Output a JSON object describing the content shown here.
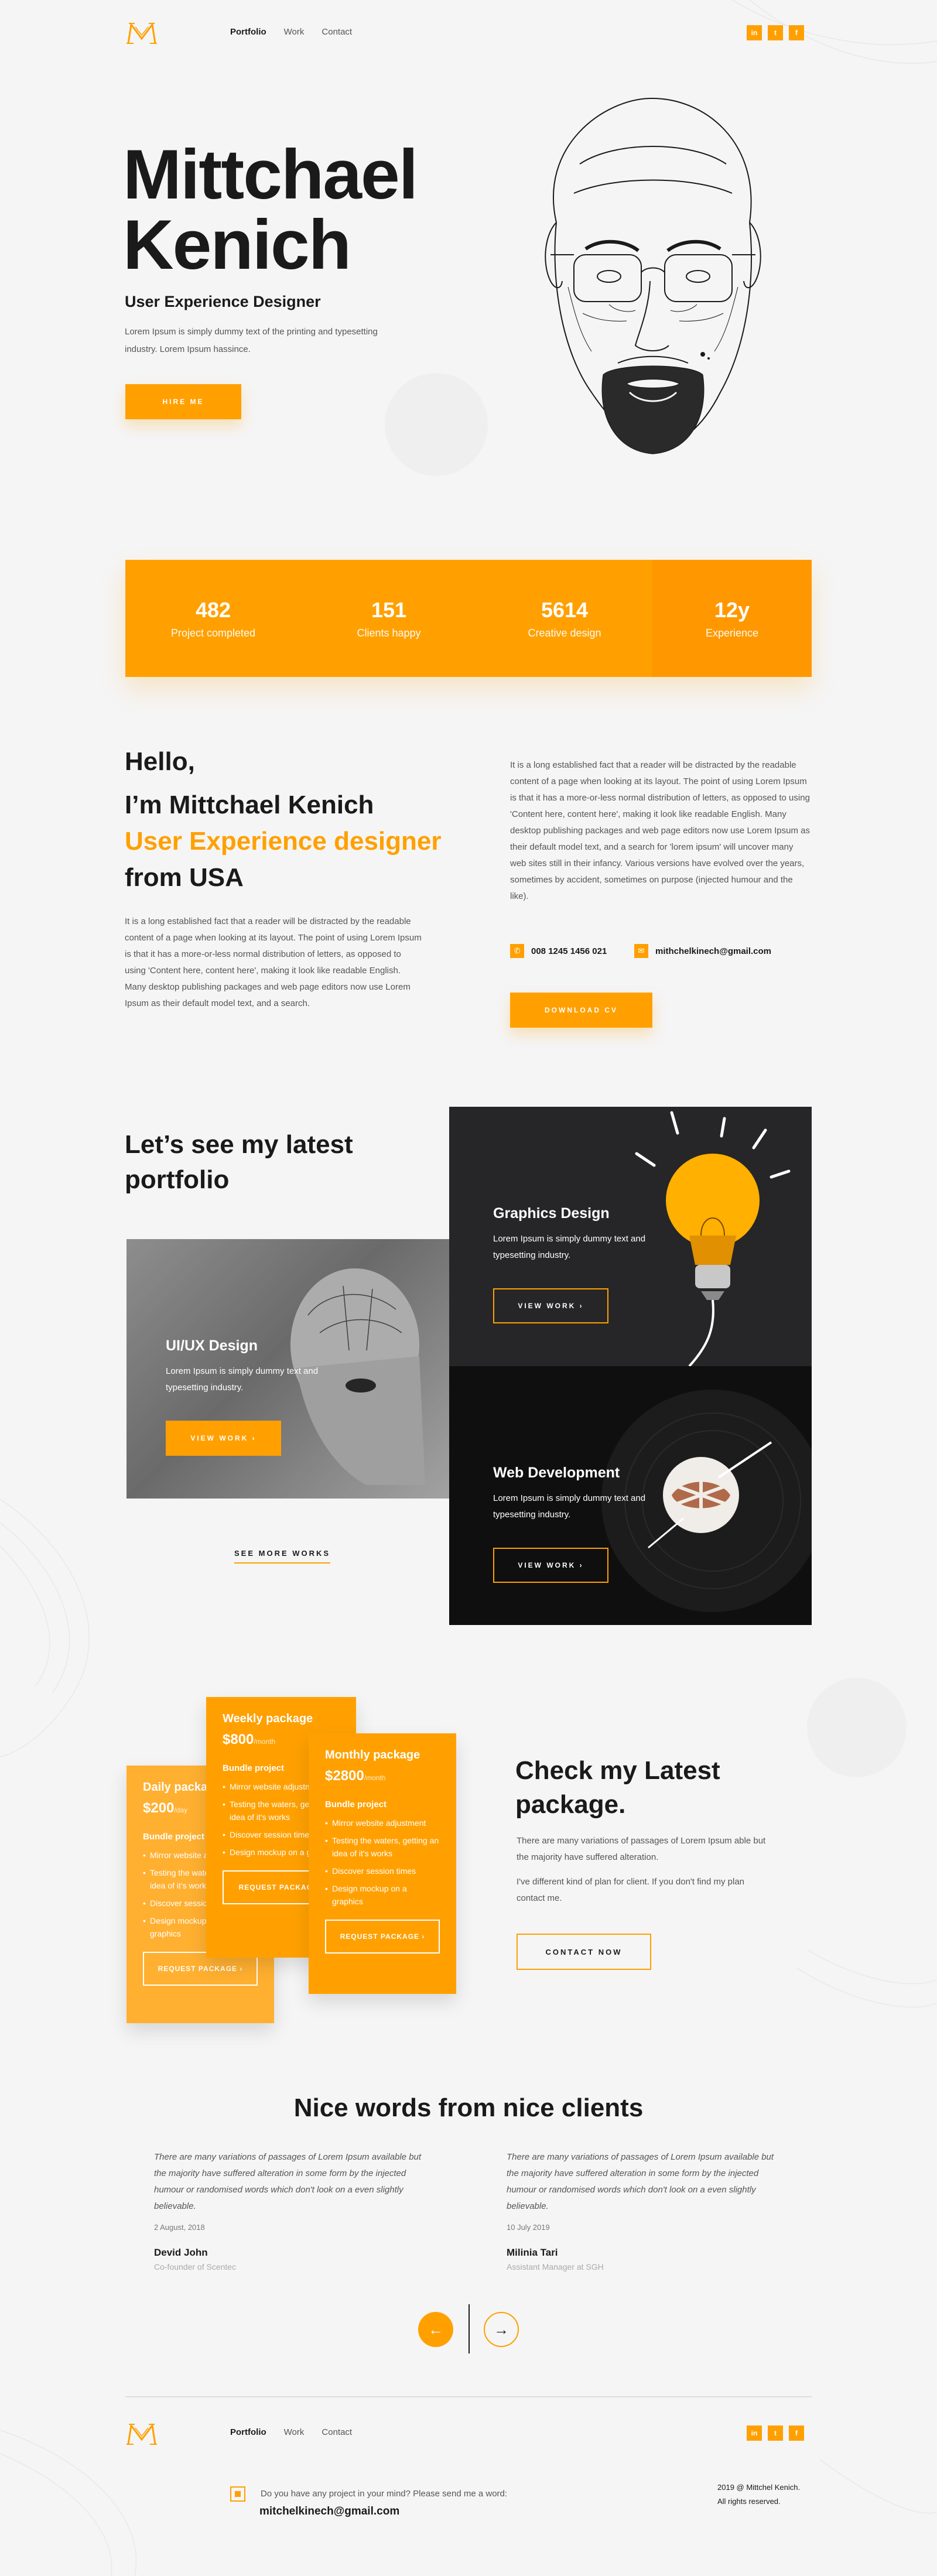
{
  "header": {
    "nav": [
      "Portfolio",
      "Work",
      "Contact"
    ],
    "social": [
      "in",
      "t",
      "f"
    ]
  },
  "hero": {
    "name_line1": "Mittchael",
    "name_line2": "Kenich",
    "role": "User Experience Designer",
    "desc": "Lorem Ipsum is simply dummy text of the printing and typesetting industry. Lorem Ipsum hassince.",
    "cta": "HIRE ME"
  },
  "stats": [
    {
      "value": "482",
      "label": "Project completed"
    },
    {
      "value": "151",
      "label": "Clients happy"
    },
    {
      "value": "5614",
      "label": "Creative design"
    },
    {
      "value": "12y",
      "label": "Experience"
    }
  ],
  "about": {
    "hello": "Hello,",
    "intro": "I’m Mittchael Kenich",
    "role": "User Experience designer",
    "from": "from USA",
    "para_left": "It is a long established fact that a reader will be distracted by the readable content of a page when looking at its layout. The point of using Lorem Ipsum is that it has a more-or-less normal distribution of letters, as opposed to using 'Content here, content here', making it look like readable English. Many desktop publishing packages and web page editors now use Lorem Ipsum as their default model text, and a search.",
    "para_right": "It is a long established fact that a reader will be distracted by the readable content of a page when looking at its layout. The point of using Lorem Ipsum is that it has a more-or-less normal distribution of letters, as opposed to using 'Content here, content here', making it look like readable English. Many desktop publishing packages and web page editors now use Lorem Ipsum as their default model text, and a search for 'lorem ipsum' will uncover many web sites still in their infancy. Various versions have evolved over the years, sometimes by accident, sometimes on purpose (injected humour and the like).",
    "phone": "008 1245 1456 021",
    "email": "mithchelkinech@gmail.com",
    "cta": "DOWNLOAD CV"
  },
  "portfolio": {
    "title_line1": "Let’s see my latest",
    "title_line2": "portfolio",
    "cards": [
      {
        "title": "UI/UX Design",
        "desc": "Lorem Ipsum is simply dummy text and typesetting industry.",
        "cta": "VIEW WORK ›"
      },
      {
        "title": "Graphics Design",
        "desc": "Lorem Ipsum is simply dummy text and typesetting industry.",
        "cta": "VIEW WORK ›"
      },
      {
        "title": "Web Development",
        "desc": "Lorem Ipsum is simply dummy text and typesetting industry.",
        "cta": "VIEW WORK ›"
      }
    ],
    "more": "SEE MORE WORKS"
  },
  "packages": {
    "items": [
      {
        "name": "Daily package",
        "price": "$200",
        "unit": "/day",
        "heading": "Bundle project",
        "features": [
          "Mirror website adjustment",
          "Testing the waters, getting an idea of it's works",
          "Discover session times",
          "Design mockup on a graphics"
        ],
        "cta": "REQUEST PACKAGE ›"
      },
      {
        "name": "Weekly package",
        "price": "$800",
        "unit": "/month",
        "heading": "Bundle project",
        "features": [
          "Mirror website adjustment",
          "Testing the waters, getting an idea of it's works",
          "Discover session times",
          "Design mockup on a graphics"
        ],
        "cta": "REQUEST PACKAGE ›"
      },
      {
        "name": "Monthly package",
        "price": "$2800",
        "unit": "/month",
        "heading": "Bundle project",
        "features": [
          "Mirror website adjustment",
          "Testing the waters, getting an idea of it's works",
          "Discover session times",
          "Design mockup on a graphics"
        ],
        "cta": "REQUEST PACKAGE ›"
      }
    ],
    "title_line1": "Check my Latest",
    "title_line2": "package.",
    "desc": "There are many variations of passages of Lorem Ipsum able but the majority have suffered alteration.",
    "note": "I've different kind of plan for client. If you don't find my plan contact me.",
    "cta": "CONTACT NOW"
  },
  "testimonials": {
    "title": "Nice words from nice clients",
    "items": [
      {
        "quote": "There are many variations of passages of Lorem Ipsum available but the majority have suffered alteration in some form by the injected humour or randomised words which don't look on a even slightly believable.",
        "date": "2 August, 2018",
        "name": "Devid John",
        "role": "Co-founder of Scentec"
      },
      {
        "quote": "There are many variations of passages of Lorem Ipsum available but the majority have suffered alteration in some form by the injected humour or randomised words which don't look on a even slightly believable.",
        "date": "10 July 2019",
        "name": "Milinia Tari",
        "role": "Assistant Manager at SGH"
      }
    ],
    "prev": "←",
    "next": "→"
  },
  "footer": {
    "nav": [
      "Portfolio",
      "Work",
      "Contact"
    ],
    "social": [
      "in",
      "t",
      "f"
    ],
    "prompt": "Do you have any project in your mind? Please send me a word:",
    "email": "mitchelkinech@gmail.com",
    "copyright_line1": "2019 @ Mittchel Kenich.",
    "copyright_line2": "All rights reserved."
  },
  "colors": {
    "accent": "#ffa000",
    "background": "#f5f5f5",
    "dark": "#1a1a1a"
  },
  "icons": [
    "logo-m-icon",
    "linkedin-icon",
    "twitter-icon",
    "facebook-icon",
    "phone-icon",
    "mail-icon",
    "arrow-left-icon",
    "arrow-right-icon",
    "portrait-illustration",
    "lightbulb-image",
    "vinyl-record-image",
    "head-sculpture-image"
  ]
}
